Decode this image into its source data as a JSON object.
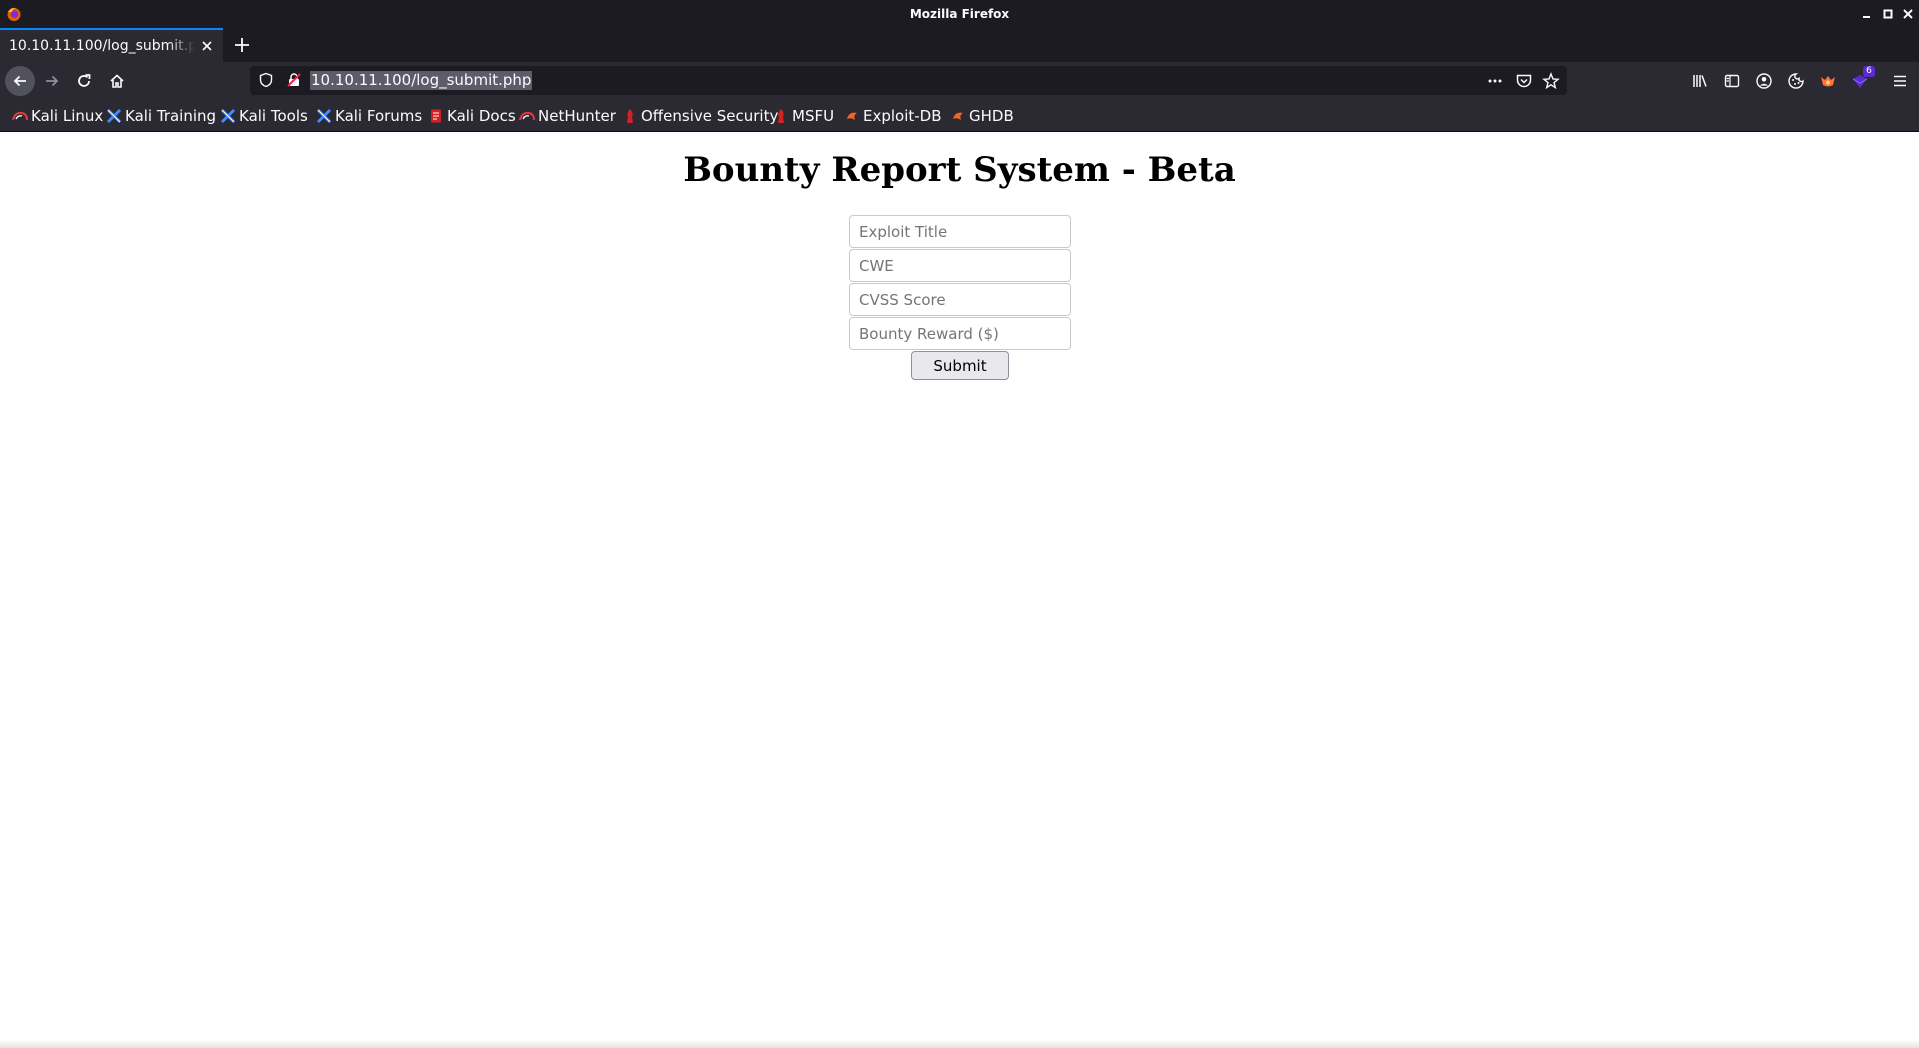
{
  "window": {
    "title": "Mozilla Firefox",
    "app_icon": "firefox-icon"
  },
  "tab": {
    "title": "10.10.11.100/log_submit.php",
    "close_icon": "close-icon"
  },
  "toolbar": {
    "url": "10.10.11.100/log_submit.php",
    "notification_count": "6"
  },
  "bookmarks": [
    {
      "label": "Kali Linux",
      "icon": "kali-linux-icon"
    },
    {
      "label": "Kali Training",
      "icon": "kali-training-icon"
    },
    {
      "label": "Kali Tools",
      "icon": "kali-tools-icon"
    },
    {
      "label": "Kali Forums",
      "icon": "kali-forums-icon"
    },
    {
      "label": "Kali Docs",
      "icon": "kali-docs-icon"
    },
    {
      "label": "NetHunter",
      "icon": "nethunter-icon"
    },
    {
      "label": "Offensive Security",
      "icon": "offsec-icon"
    },
    {
      "label": "MSFU",
      "icon": "msfu-icon"
    },
    {
      "label": "Exploit-DB",
      "icon": "exploit-db-icon"
    },
    {
      "label": "GHDB",
      "icon": "ghdb-icon"
    }
  ],
  "page": {
    "heading": "Bounty Report System - Beta",
    "fields": [
      {
        "placeholder": "Exploit Title",
        "value": ""
      },
      {
        "placeholder": "CWE",
        "value": ""
      },
      {
        "placeholder": "CVSS Score",
        "value": ""
      },
      {
        "placeholder": "Bounty Reward ($)",
        "value": ""
      }
    ],
    "submit_label": "Submit"
  },
  "colors": {
    "titlebar_bg": "#1c1b22",
    "toolbar_bg": "#2b2a33",
    "tab_accent": "#0a84ff",
    "page_bg": "#ffffff"
  }
}
